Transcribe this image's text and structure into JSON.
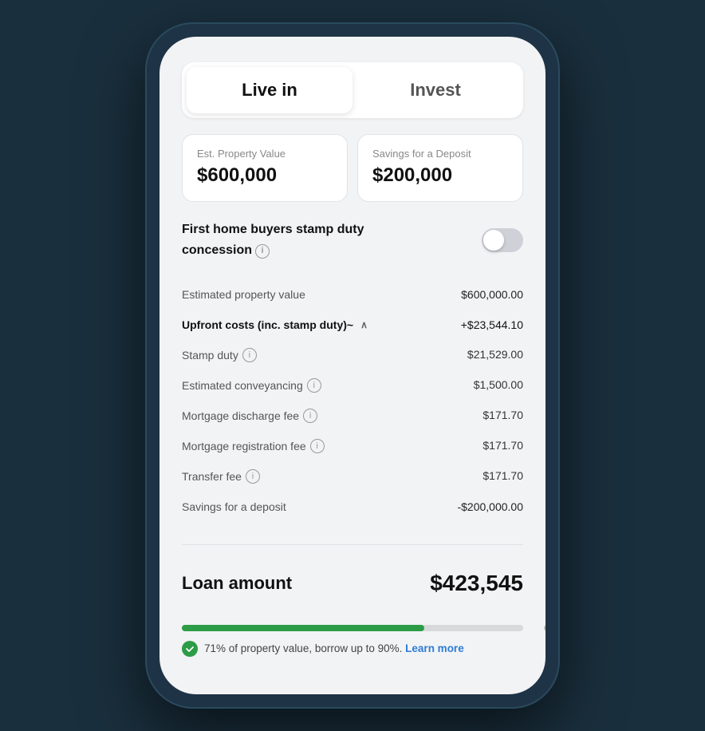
{
  "tabs": [
    {
      "id": "live-in",
      "label": "Live in",
      "active": true
    },
    {
      "id": "invest",
      "label": "Invest",
      "active": false
    }
  ],
  "inputs": {
    "property_value": {
      "label": "Est. Property Value",
      "value": "$600,000"
    },
    "savings_deposit": {
      "label": "Savings for a Deposit",
      "value": "$200,000"
    }
  },
  "stamp_duty_section": {
    "label_part1": "First home buyers stamp duty",
    "label_part2": "concession",
    "toggle_on": false
  },
  "line_items": {
    "estimated_property": {
      "label": "Estimated property value",
      "value": "$600,000.00"
    },
    "upfront_costs": {
      "label": "Upfront costs (inc. stamp duty)~",
      "value": "+$23,544.10",
      "expanded": true
    },
    "sub_items": [
      {
        "label": "Stamp duty",
        "has_info": true,
        "value": "$21,529.00"
      },
      {
        "label": "Estimated conveyancing",
        "has_info": true,
        "value": "$1,500.00"
      },
      {
        "label": "Mortgage discharge fee",
        "has_info": true,
        "value": "$171.70"
      },
      {
        "label": "Mortgage registration fee",
        "has_info": true,
        "value": "$171.70"
      },
      {
        "label": "Transfer fee",
        "has_info": true,
        "value": "$171.70"
      }
    ],
    "savings_deposit": {
      "label": "Savings for a deposit",
      "value": "-$200,000.00"
    }
  },
  "loan_amount": {
    "label": "Loan amount",
    "value": "$423,545"
  },
  "progress": {
    "percentage": 71,
    "note_text": "71% of property value, borrow up to 90%.",
    "learn_more_text": "Learn more"
  },
  "icons": {
    "info": "i",
    "check": "✓",
    "chevron_up": "∧"
  }
}
